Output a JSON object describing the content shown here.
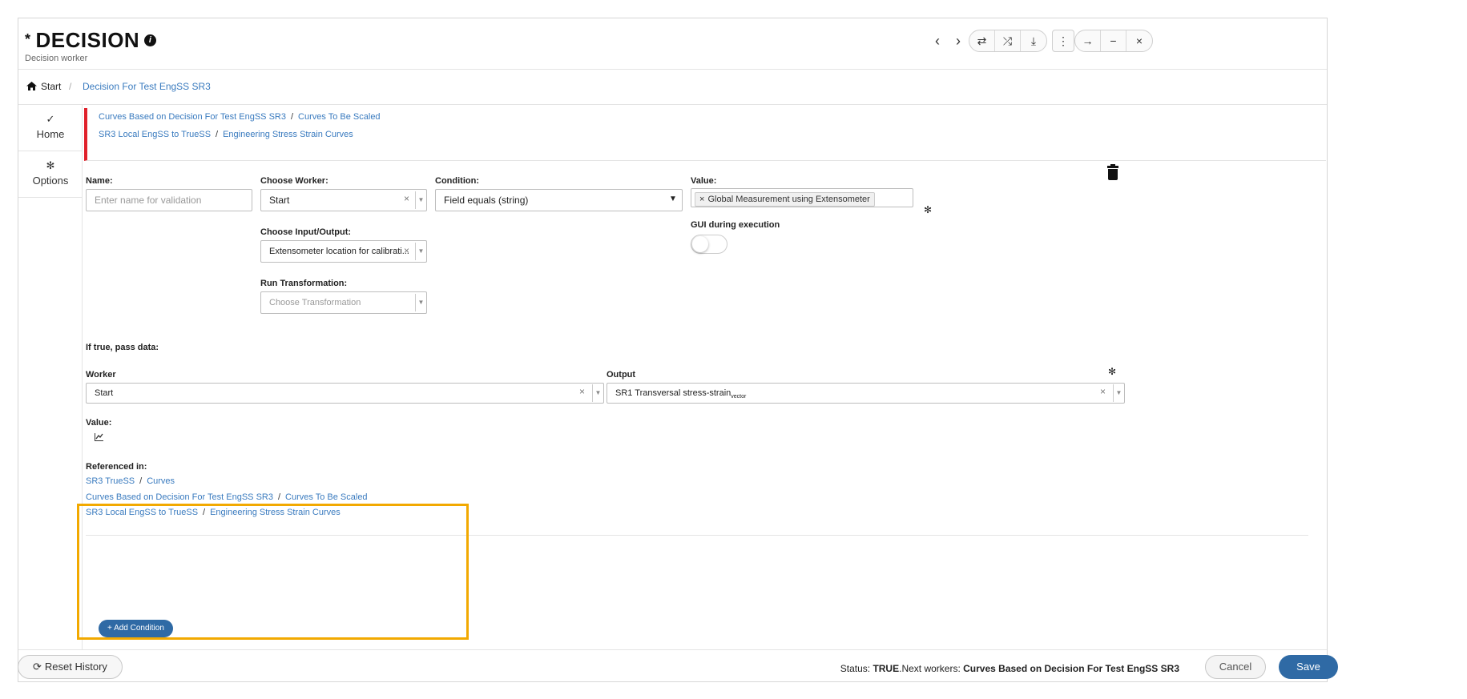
{
  "header": {
    "title_prefix": "*",
    "title": "DECISION",
    "subtitle": "Decision worker"
  },
  "toolbar": {
    "prev": "‹",
    "next": "›",
    "g1": [
      "⇄",
      "⤮",
      "⤓"
    ],
    "kebab": "⋮",
    "g2": [
      "→",
      "−",
      "×"
    ]
  },
  "breadcrumb": {
    "home": "Start",
    "separator": "/",
    "current": "Decision For Test EngSS SR3"
  },
  "sidebar": {
    "items": [
      {
        "label": "Home",
        "icon": "check-double-icon"
      },
      {
        "label": "Options",
        "icon": "gear-icon"
      }
    ]
  },
  "top_refs": [
    {
      "a": "Curves Based on Decision For Test EngSS SR3",
      "b": "Curves To Be Scaled"
    },
    {
      "a": "SR3 Local EngSS to TrueSS",
      "b": "Engineering Stress Strain Curves"
    }
  ],
  "form": {
    "name_label": "Name:",
    "name_placeholder": "Enter name for validation",
    "worker_label": "Choose Worker:",
    "worker_value": "Start",
    "condition_label": "Condition:",
    "condition_value": "Field equals (string)",
    "value_label": "Value:",
    "value_tag": "Global Measurement using Extensometer",
    "io_label": "Choose Input/Output:",
    "io_value": "Extensometer location for calibrati...",
    "gui_label": "GUI during execution",
    "gui_on": false,
    "transform_label": "Run Transformation:",
    "transform_placeholder": "Choose Transformation"
  },
  "pass": {
    "title": "If true, pass data:",
    "worker_label": "Worker",
    "worker_value": "Start",
    "output_label": "Output",
    "output_value": "SR1 Transversal stress-strain",
    "output_sub": "vector",
    "value_label": "Value:"
  },
  "referenced": {
    "title": "Referenced in:",
    "items": [
      {
        "a": "SR3 TrueSS",
        "b": "Curves"
      },
      {
        "a": "Curves Based on Decision For Test EngSS SR3",
        "b": "Curves To Be Scaled"
      },
      {
        "a": "SR3 Local EngSS to TrueSS",
        "b": "Engineering Stress Strain Curves"
      }
    ]
  },
  "add_condition": "+ Add Condition",
  "footer": {
    "reset": "Reset History",
    "status_label": "Status:",
    "status_value": "TRUE",
    "next_label": ".Next workers:",
    "next_value": "Curves Based on Decision For Test EngSS SR3",
    "cancel": "Cancel",
    "save": "Save"
  },
  "colors": {
    "accent": "#2f6aa5",
    "link": "#3a7bbf",
    "error_bar": "#e0202a",
    "highlight": "#f2a900"
  }
}
